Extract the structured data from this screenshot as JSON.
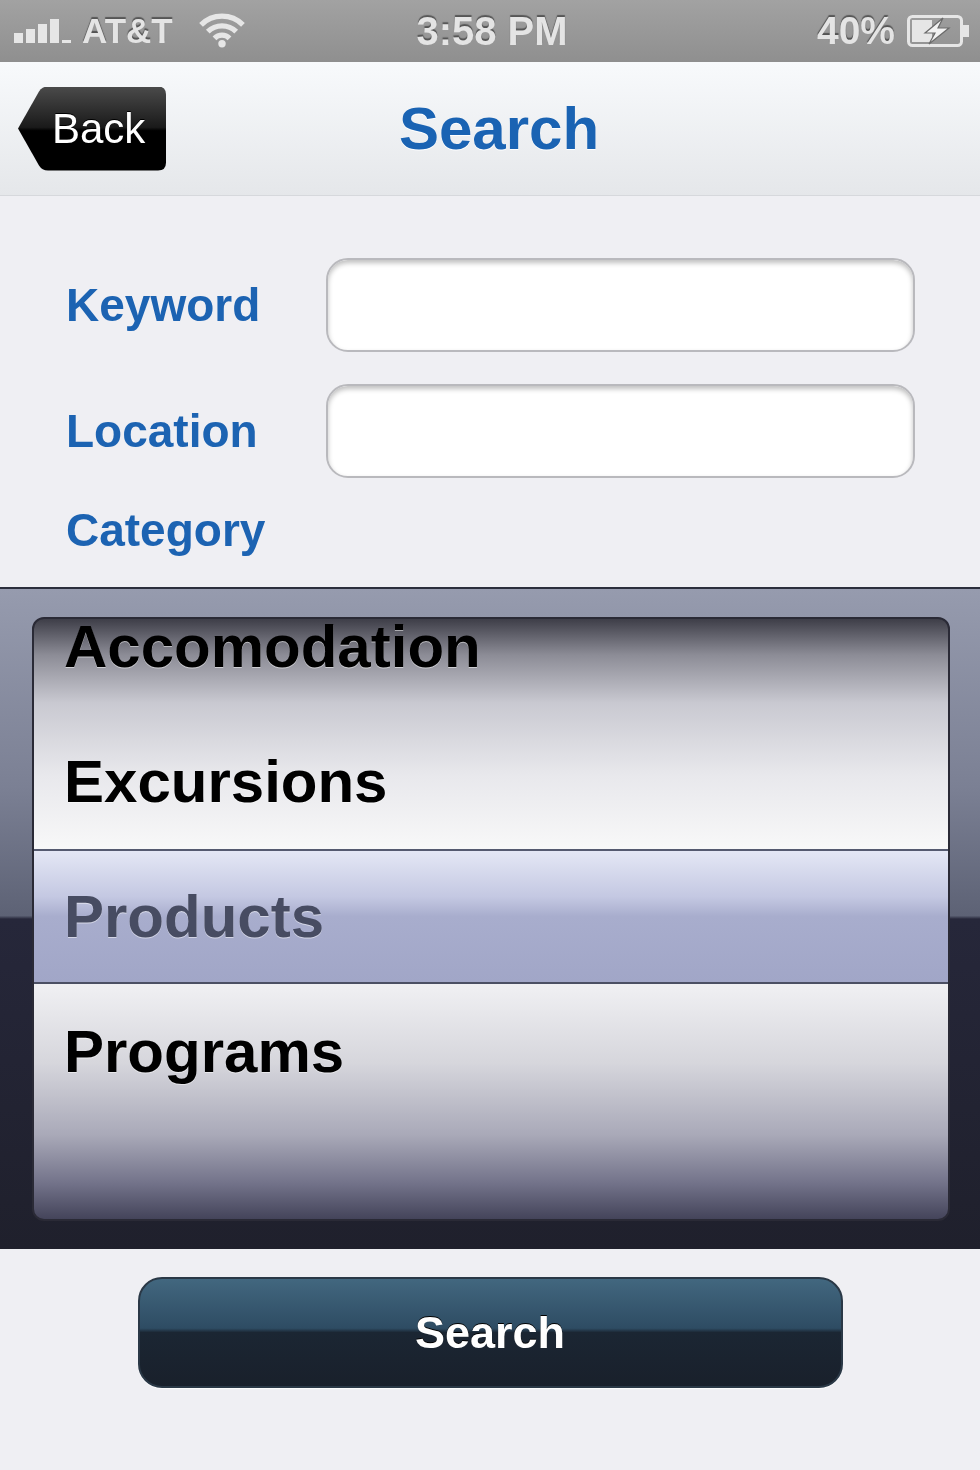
{
  "status_bar": {
    "carrier": "AT&T",
    "time": "3:58 PM",
    "battery": "40%",
    "charging": true
  },
  "nav_bar": {
    "back_button": "Back",
    "title": "Search"
  },
  "form": {
    "fields": [
      {
        "label": "Keyword"
      },
      {
        "label": "Location"
      }
    ],
    "category_label": "Category"
  },
  "picker": {
    "options": [
      {
        "label": "Accomodation",
        "selected": false
      },
      {
        "label": "Excursions",
        "selected": false
      },
      {
        "label": "Products",
        "selected": true
      },
      {
        "label": "Programs",
        "selected": false
      }
    ]
  },
  "search_button": "Search"
}
